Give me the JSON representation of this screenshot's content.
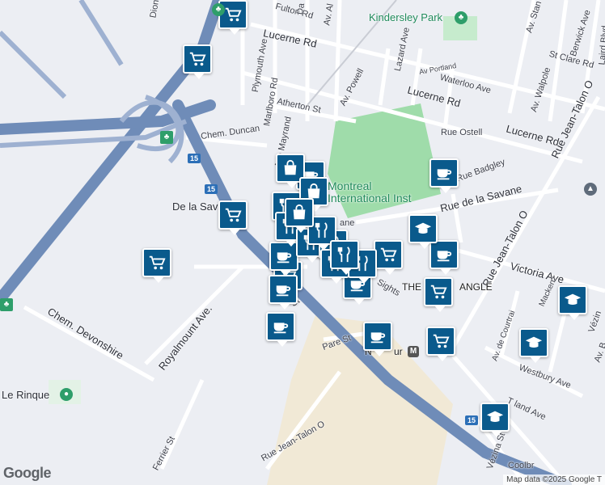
{
  "map": {
    "streets": [
      {
        "id": "fulton",
        "text": "Fulton Rd"
      },
      {
        "id": "lucerne1",
        "text": "Lucerne Rd"
      },
      {
        "id": "lucerne2",
        "text": "Lucerne Rd"
      },
      {
        "id": "lucerne3",
        "text": "Lucerne Rd"
      },
      {
        "id": "plymouth",
        "text": "Plymouth Ave"
      },
      {
        "id": "marlboro",
        "text": "Marlboro Rd"
      },
      {
        "id": "atherton",
        "text": "Atherton St"
      },
      {
        "id": "duncan",
        "text": "Chem. Duncan"
      },
      {
        "id": "mayrand",
        "text": "Ave Mayrand"
      },
      {
        "id": "powell",
        "text": "Av. Powell"
      },
      {
        "id": "lazard",
        "text": "Lazard Ave"
      },
      {
        "id": "portland",
        "text": "Av Portland"
      },
      {
        "id": "waterloo",
        "text": "Waterloo Ave"
      },
      {
        "id": "walpole",
        "text": "Av. Walpole"
      },
      {
        "id": "stclare",
        "text": "St Clare Rd"
      },
      {
        "id": "berwick",
        "text": "Berwick Ave"
      },
      {
        "id": "stanst",
        "text": "Av. Stan"
      },
      {
        "id": "laird",
        "text": "Laird Blvd"
      },
      {
        "id": "jeantalon1",
        "text": "Rue Jean-Talon O"
      },
      {
        "id": "jeantalon2",
        "text": "Rue Jean-Talon O"
      },
      {
        "id": "jeantalon3",
        "text": "Rue Jean-Talon O"
      },
      {
        "id": "ostell",
        "text": "Rue Ostell"
      },
      {
        "id": "badgley",
        "text": "Rue Badgley"
      },
      {
        "id": "savane",
        "text": "Rue de la Savane"
      },
      {
        "id": "delasav",
        "text": "De la Sav"
      },
      {
        "id": "victoria",
        "text": "Victoria Ave"
      },
      {
        "id": "courtrai",
        "text": "Av. de Courtrai"
      },
      {
        "id": "mackenzie",
        "text": "Mackenz"
      },
      {
        "id": "westbury",
        "text": "Westbury Ave"
      },
      {
        "id": "vezina1",
        "text": "Vézin"
      },
      {
        "id": "vezina2",
        "text": "Vézina St"
      },
      {
        "id": "devonshire",
        "text": "Chem. Devonshire"
      },
      {
        "id": "royalmount",
        "text": "Royalmount Ave."
      },
      {
        "id": "pare",
        "text": "Pare St"
      },
      {
        "id": "ferrier",
        "text": "Ferrier St"
      },
      {
        "id": "sights",
        "text": "Sights"
      },
      {
        "id": "coolbr",
        "text": "Coolbr"
      },
      {
        "id": "dion",
        "text": "Dion"
      },
      {
        "id": "da",
        "text": "Da"
      },
      {
        "id": "avalt",
        "text": "Av. Al"
      },
      {
        "id": "edland",
        "text": "T land Ave"
      },
      {
        "id": "lane",
        "text": "ane"
      },
      {
        "id": "stx",
        "text": "St"
      },
      {
        "id": "ave_b",
        "text": "Av. B"
      }
    ],
    "places": {
      "kindersley": "Kindersley Park",
      "montreal_inst_1": "Montreal",
      "montreal_inst_2": "International Inst",
      "triangle_a": "THE",
      "triangle_b": "ANGLE",
      "namur": "N",
      "namur2": "ur",
      "rinque": "Le Rinque"
    },
    "highway": "15",
    "metro": "M",
    "google_logo": "Google",
    "attribution": "Map data ©2025 Google",
    "attribution_extra": "T",
    "pins": [
      {
        "type": "grocery"
      },
      {
        "type": "grocery"
      },
      {
        "type": "grocery"
      },
      {
        "type": "grocery"
      },
      {
        "type": "grocery"
      },
      {
        "type": "grocery"
      },
      {
        "type": "grocery"
      },
      {
        "type": "grocery"
      },
      {
        "type": "cafe"
      },
      {
        "type": "cafe"
      },
      {
        "type": "cafe"
      },
      {
        "type": "cafe"
      },
      {
        "type": "cafe"
      },
      {
        "type": "cafe"
      },
      {
        "type": "cafe"
      },
      {
        "type": "cafe"
      },
      {
        "type": "cafe"
      },
      {
        "type": "restaurant"
      },
      {
        "type": "restaurant"
      },
      {
        "type": "restaurant"
      },
      {
        "type": "restaurant"
      },
      {
        "type": "restaurant"
      },
      {
        "type": "restaurant"
      },
      {
        "type": "restaurant"
      },
      {
        "type": "restaurant"
      },
      {
        "type": "shopping"
      },
      {
        "type": "shopping"
      },
      {
        "type": "shopping"
      },
      {
        "type": "school"
      },
      {
        "type": "school"
      },
      {
        "type": "school"
      },
      {
        "type": "school"
      }
    ],
    "colors": {
      "pin": "#0a5a8c",
      "highway": "#6f8cb8",
      "park": "#9fdcaa",
      "land": "#eceef3",
      "industrial": "#f1e9d6"
    }
  }
}
